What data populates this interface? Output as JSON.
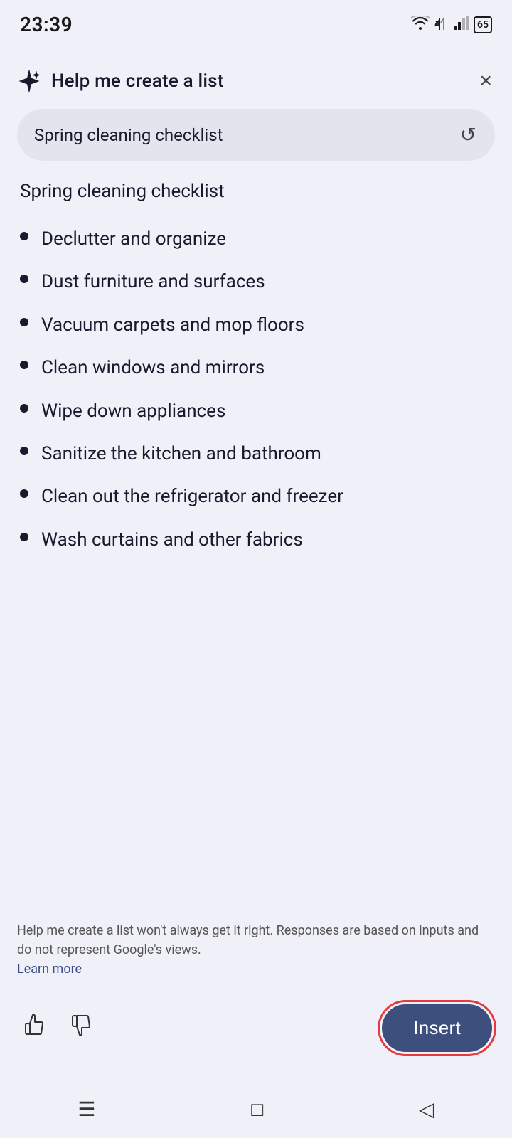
{
  "statusBar": {
    "time": "23:39",
    "battery": "65"
  },
  "header": {
    "title": "Help me create a list",
    "closeLabel": "×"
  },
  "inputArea": {
    "value": "Spring cleaning checklist",
    "refreshLabel": "↺"
  },
  "content": {
    "listTitle": "Spring cleaning checklist",
    "items": [
      "Declutter and organize",
      "Dust furniture and surfaces",
      "Vacuum carpets and mop floors",
      "Clean windows and mirrors",
      "Wipe down appliances",
      "Sanitize the kitchen and bathroom",
      "Clean out the refrigerator and freezer",
      "Wash curtains and other fabrics"
    ]
  },
  "disclaimer": {
    "text": "Help me create a list won't always get it right. Responses are based on inputs and do not represent Google's views.",
    "learnMoreLabel": "Learn more"
  },
  "actions": {
    "thumbUpLabel": "👍",
    "thumbDownLabel": "👎",
    "insertLabel": "Insert"
  },
  "navBar": {
    "menuIcon": "☰",
    "homeIcon": "□",
    "backIcon": "◁"
  }
}
